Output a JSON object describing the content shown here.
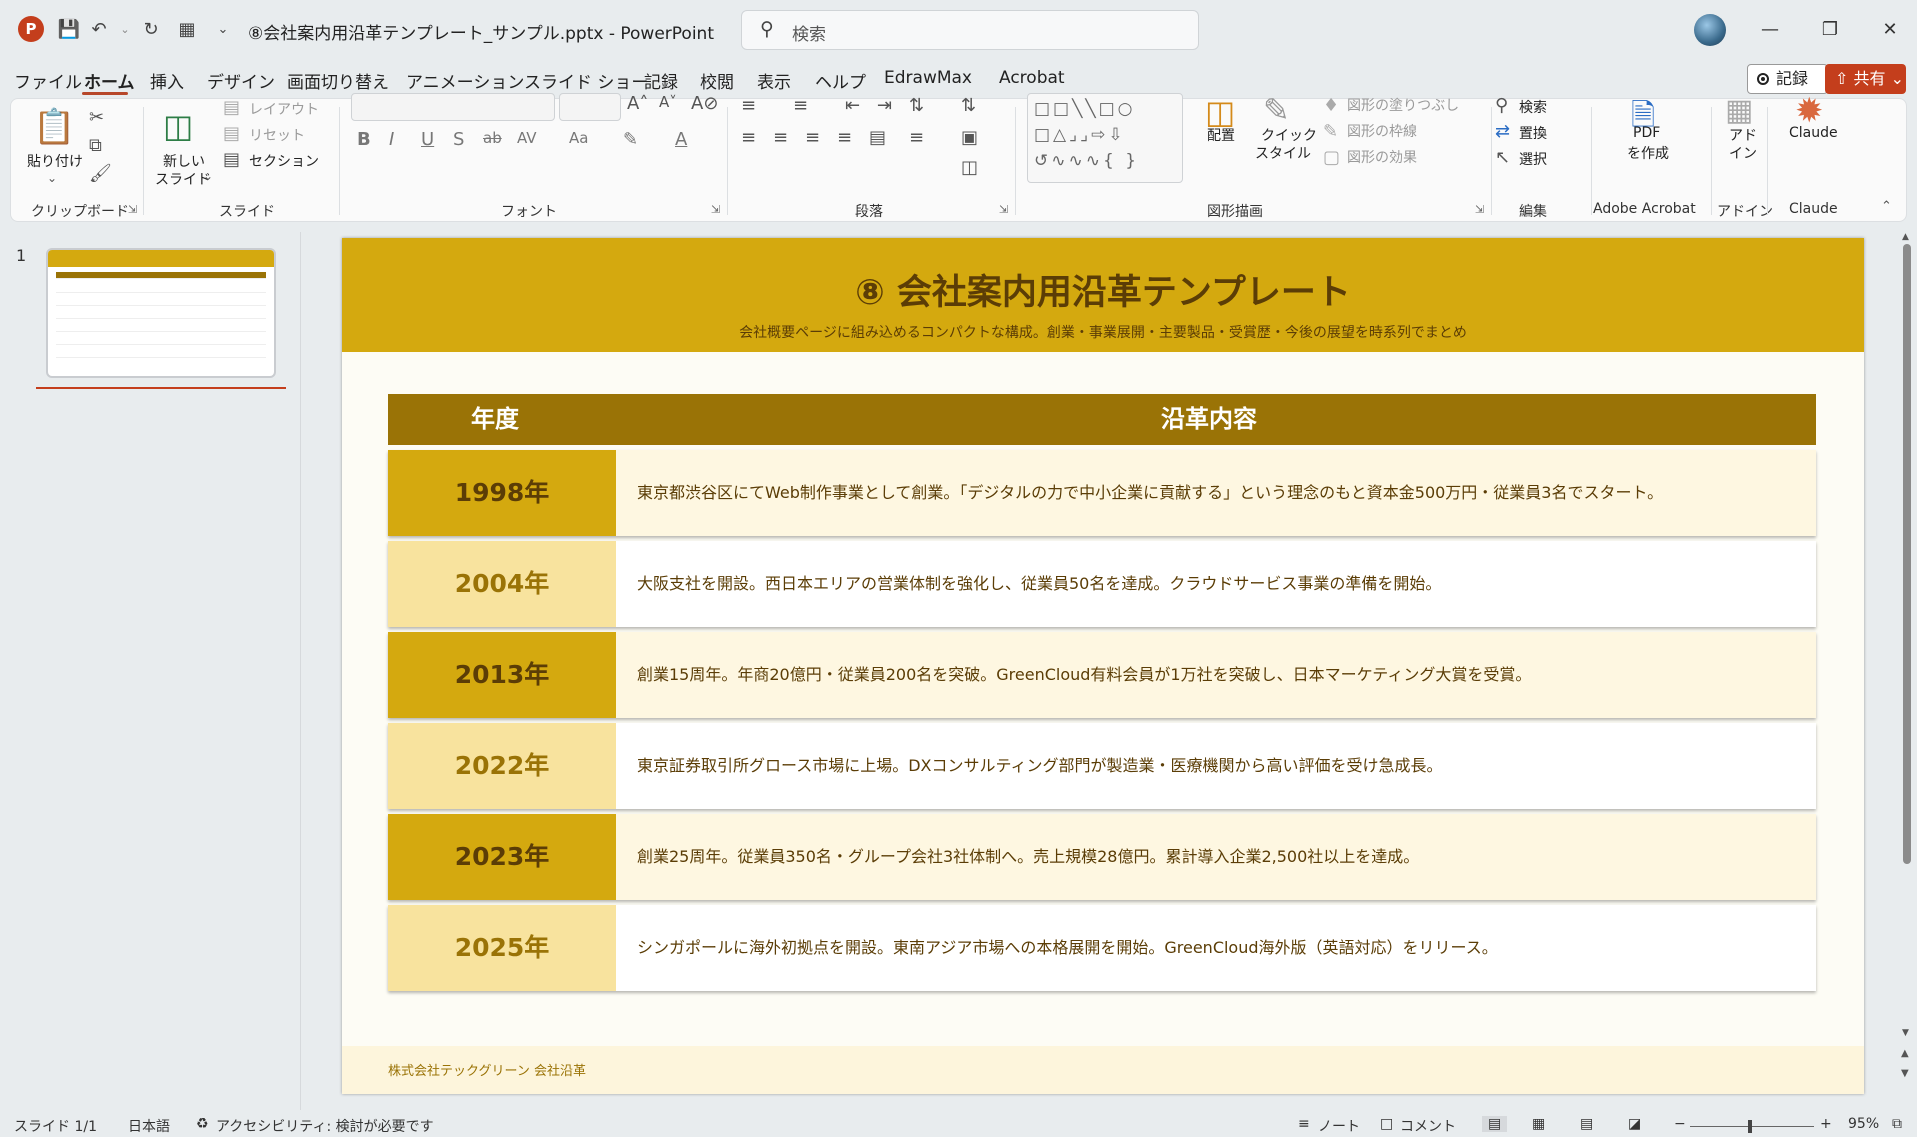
{
  "app": {
    "title": "⑧会社案内用沿革テンプレート_サンプル.pptx  -  PowerPoint",
    "search_placeholder": "検索",
    "brand_color": "#c43e1c"
  },
  "menu": {
    "items": [
      "ファイル",
      "ホーム",
      "挿入",
      "デザイン",
      "画面切り替え",
      "アニメーション",
      "スライド ショー",
      "記録",
      "校閲",
      "表示",
      "ヘルプ",
      "EdrawMax",
      "Acrobat"
    ],
    "record_label": "記録",
    "share_label": "共有"
  },
  "ribbon": {
    "clipboard": {
      "paste": "貼り付け",
      "group": "クリップボード"
    },
    "slides": {
      "new_slide": "新しい",
      "new_slide2": "スライド",
      "layout": "レイアウト",
      "reset": "リセット",
      "section": "セクション",
      "group": "スライド"
    },
    "font": {
      "group": "フォント"
    },
    "paragraph": {
      "group": "段落"
    },
    "drawing": {
      "arrange": "配置",
      "quick_style": "クイック",
      "quick_style2": "スタイル",
      "fill": "図形の塗りつぶし",
      "outline": "図形の枠線",
      "effects": "図形の効果",
      "group": "図形描画"
    },
    "editing": {
      "find": "検索",
      "replace": "置換",
      "select": "選択",
      "group": "編集"
    },
    "acrobat": {
      "pdf": "PDF",
      "pdf2": "を作成",
      "group": "Adobe Acrobat"
    },
    "addin": {
      "label": "アド",
      "label2": "イン",
      "group": "アドイン"
    },
    "claude": {
      "label": "Claude",
      "group": "Claude"
    }
  },
  "thumbnails": {
    "number": "1"
  },
  "slide": {
    "title": "⑧ 会社案内用沿革テンプレート",
    "subtitle": "会社概要ページに組み込めるコンパクトな構成。創業・事業展開・主要製品・受賞歴・今後の展望を時系列でまとめ",
    "table": {
      "header_year": "年度",
      "header_content": "沿革内容",
      "rows": [
        {
          "year": "1998年",
          "text": "東京都渋谷区にてWeb制作事業として創業。「デジタルの力で中小企業に貢献する」という理念のもと資本金500万円・従業員3名でスタート。"
        },
        {
          "year": "2004年",
          "text": "大阪支社を開設。西日本エリアの営業体制を強化し、従業員50名を達成。クラウドサービス事業の準備を開始。"
        },
        {
          "year": "2013年",
          "text": "創業15周年。年商20億円・従業員200名を突破。GreenCloud有料会員が1万社を突破し、日本マーケティング大賞を受賞。"
        },
        {
          "year": "2022年",
          "text": "東京証券取引所グロース市場に上場。DXコンサルティング部門が製造業・医療機関から高い評価を受け急成長。"
        },
        {
          "year": "2023年",
          "text": "創業25周年。従業員350名・グループ会社3社体制へ。売上規模28億円。累計導入企業2,500社以上を達成。"
        },
        {
          "year": "2025年",
          "text": "シンガポールに海外初拠点を開設。東南アジア市場への本格展開を開始。GreenCloud海外版（英語対応）をリリース。"
        }
      ]
    },
    "footer": "株式会社テックグリーン 会社沿革",
    "colors": {
      "header": "#d4a90f",
      "table_head": "#9a7306",
      "dark_year": "#d4a90f",
      "light_year": "#f8e39e"
    }
  },
  "status": {
    "slide": "スライド 1/1",
    "language": "日本語",
    "accessibility": "アクセシビリティ: 検討が必要です",
    "notes": "ノート",
    "comments": "コメント",
    "zoom": "95%"
  }
}
